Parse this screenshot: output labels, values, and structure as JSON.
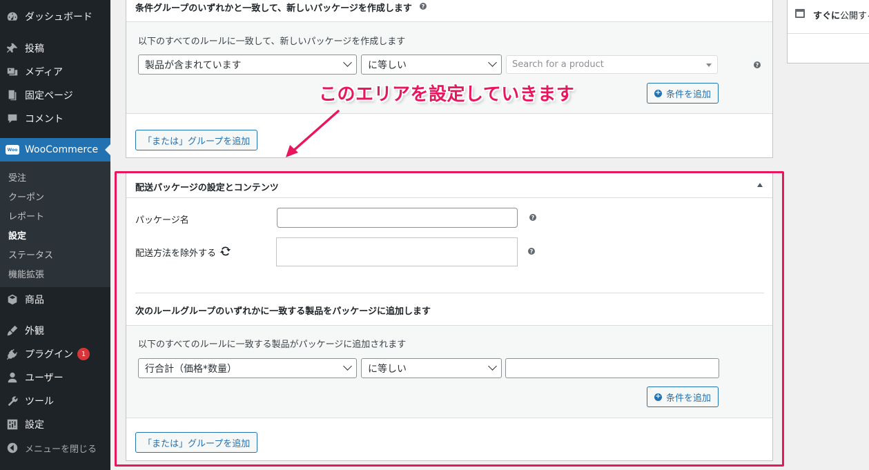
{
  "sidebar": {
    "items": [
      {
        "label": "ダッシュボード",
        "icon": "dashboard-icon"
      },
      {
        "label": "投稿",
        "icon": "pin-icon"
      },
      {
        "label": "メディア",
        "icon": "media-icon"
      },
      {
        "label": "固定ページ",
        "icon": "page-icon"
      },
      {
        "label": "コメント",
        "icon": "comment-icon"
      },
      {
        "label": "WooCommerce",
        "icon": "woo-icon"
      },
      {
        "label": "商品",
        "icon": "box-icon"
      },
      {
        "label": "外観",
        "icon": "brush-icon"
      },
      {
        "label": "プラグイン",
        "icon": "plugin-icon",
        "badge": "1"
      },
      {
        "label": "ユーザー",
        "icon": "user-icon"
      },
      {
        "label": "ツール",
        "icon": "wrench-icon"
      },
      {
        "label": "設定",
        "icon": "settings-icon"
      },
      {
        "label": "メニューを閉じる",
        "icon": "collapse-icon"
      }
    ],
    "woo_logo_text": "Woo",
    "submenu": [
      "受注",
      "クーポン",
      "レポート",
      "設定",
      "ステータス",
      "機能拡張"
    ]
  },
  "top_panel": {
    "header": "条件グループのいずれかと一致して、新しいパッケージを作成します",
    "rules_intro": "以下のすべてのルールに一致して、新しいパッケージを作成します",
    "condition_select": "製品が含まれています",
    "operator_select": "に等しい",
    "product_search_placeholder": "Search for a product",
    "add_condition": "条件を追加",
    "add_or_group": "「または」グループを追加"
  },
  "publish_box": {
    "label_bold": "すぐに",
    "label_rest": "公開する"
  },
  "annotation": "このエリアを設定していきます",
  "package_panel": {
    "header": "配送パッケージの設定とコンテンツ",
    "package_name_label": "パッケージ名",
    "package_name_value": "",
    "exclude_methods_label": "配送方法を除外する",
    "rule_groups_header": "次のルールグループのいずれかに一致する製品をパッケージに追加します",
    "rules_intro": "以下のすべてのルールに一致する製品がパッケージに追加されます",
    "condition_select": "行合計（価格*数量）",
    "operator_select": "に等しい",
    "value": "",
    "add_condition": "条件を追加",
    "add_or_group": "「または」グループを追加"
  },
  "help_glyph": "?",
  "plus_glyph": "+",
  "colors": {
    "sidebar_bg": "#1d2327",
    "active_blue": "#2271b1",
    "highlight": "#e8175d",
    "badge_red": "#d63638"
  }
}
